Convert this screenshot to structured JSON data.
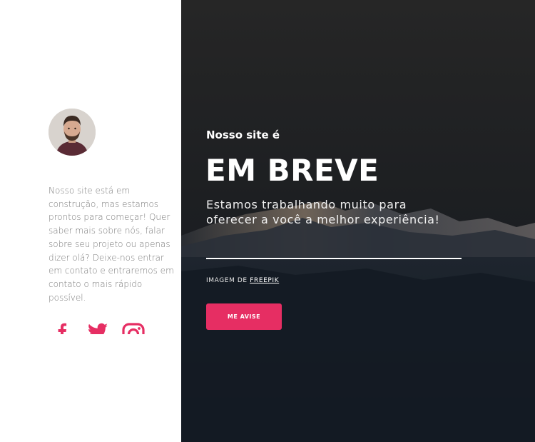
{
  "intro": {
    "avatar_alt": "",
    "text": "Nosso site está em construção, mas estamos prontos para começar! Quer saber mais sobre nós, falar sobre seu projeto ou apenas dizer olá? Deixe-nos entrar em contato e entraremos em contato o mais rápido possível."
  },
  "socials": {
    "icons": [
      "facebook-icon",
      "twitter-icon",
      "instagram-icon"
    ],
    "color": "#e62e63"
  },
  "hero": {
    "kicker": "Nosso site é",
    "headline": "EM BREVE",
    "subtitle": "Estamos trabalhando muito para oferecer a você a melhor experiência!",
    "credit_prefix": "IMAGEM DE",
    "credit_link": "FREEPIK",
    "cta_label": "ME AVISE"
  },
  "colors": {
    "accent": "#e62e63",
    "panel_dark": "#161b22",
    "body_text": "#7a7a7a"
  }
}
